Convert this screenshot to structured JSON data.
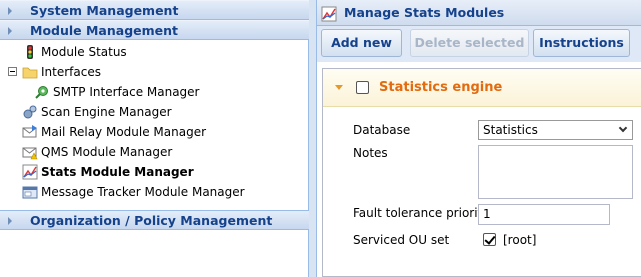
{
  "sidebar": {
    "sections": {
      "system": "System Management",
      "module": "Module Management",
      "org": "Organization / Policy Management"
    },
    "items": [
      {
        "label": "Module Status",
        "icon": "traffic-light-icon"
      },
      {
        "label": "Interfaces",
        "icon": "folder-icon"
      },
      {
        "label": "SMTP Interface Manager",
        "icon": "smtp-gear-icon"
      },
      {
        "label": "Scan Engine Manager",
        "icon": "scan-gear-icon"
      },
      {
        "label": "Mail Relay Module Manager",
        "icon": "mail-relay-icon"
      },
      {
        "label": "QMS Module Manager",
        "icon": "qms-mail-icon"
      },
      {
        "label": "Stats Module Manager",
        "icon": "stats-chart-icon"
      },
      {
        "label": "Message Tracker Module Manager",
        "icon": "tracker-window-icon"
      }
    ]
  },
  "panel": {
    "title": "Manage Stats Modules",
    "toolbar": {
      "add_label": "Add new",
      "delete_label": "Delete selected",
      "instructions_label": "Instructions"
    },
    "fieldset": {
      "title": "Statistics engine",
      "database_label": "Database",
      "database_value": "Statistics",
      "notes_label": "Notes",
      "notes_value": "",
      "fault_label": "Fault tolerance priority",
      "fault_value": "1",
      "ou_label": "Serviced OU set",
      "ou_value": "[root]"
    }
  },
  "colors": {
    "header_text": "#15428b",
    "accent_orange": "#e26b10",
    "border_blue": "#99bbe8"
  }
}
